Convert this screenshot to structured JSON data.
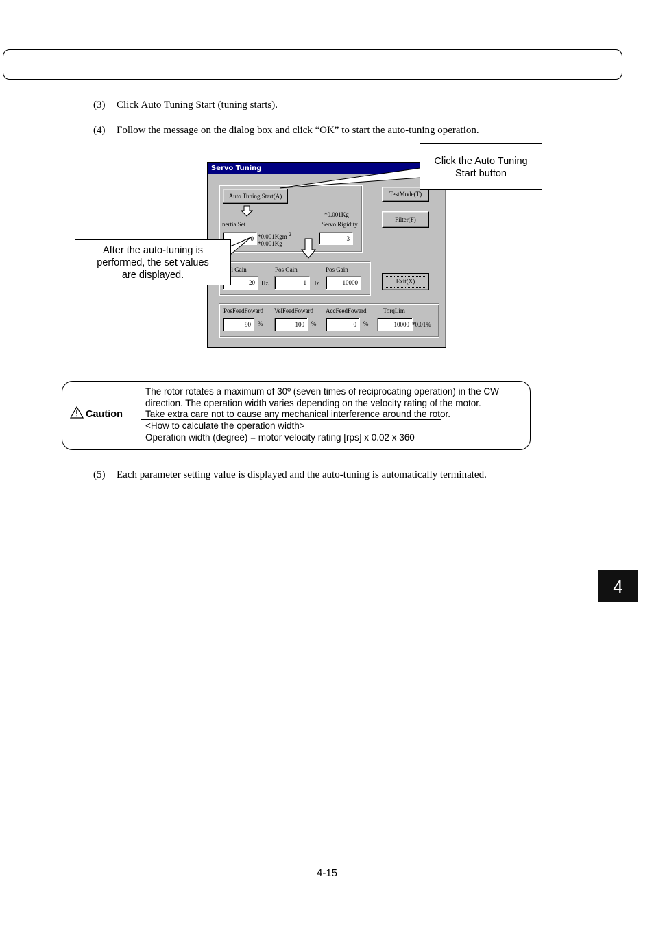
{
  "steps": [
    {
      "num": "(3)",
      "text": "Click Auto Tuning Start (tuning starts)."
    },
    {
      "num": "(4)",
      "text": "Follow the message on the dialog box and click “OK” to start the auto-tuning operation."
    },
    {
      "num": "(5)",
      "text": "Each parameter setting value is displayed and the auto-tuning is automatically terminated."
    }
  ],
  "dialog": {
    "title": "Servo Tuning",
    "auto_tuning_button": "Auto Tuning Start(A)",
    "test_mode_button": "TestMode(T)",
    "filter_button": "Filter(F)",
    "exit_button": "Exit(X)",
    "inertia_label": "Inertia Set",
    "inertia_value": "0",
    "inertia_unit1": "*0.001Kgm",
    "inertia_unit_sup": "2",
    "inertia_unit2": "*0.001Kg",
    "rigidity_unit": "*0.001Kg",
    "rigidity_label": "Servo Rigidity",
    "rigidity_value": "3",
    "vel_gain_label": "Vel Gain",
    "vel_gain_value": "20",
    "vel_gain_unit": "Hz",
    "pos_gain_label": "Pos Gain",
    "pos_gain_value": "1",
    "pos_gain_unit": "Hz",
    "pos_gain2_label": "Pos Gain",
    "pos_gain2_value": "10000",
    "pos_ff_label": "PosFeedFoward",
    "pos_ff_value": "90",
    "pos_ff_unit": "%",
    "vel_ff_label": "VelFeedFoward",
    "vel_ff_value": "100",
    "vel_ff_unit": "%",
    "acc_ff_label": "AccFeedFoward",
    "acc_ff_value": "0",
    "acc_ff_unit": "%",
    "torq_label": "TorqLim",
    "torq_value": "10000",
    "torq_unit": "*0.01%"
  },
  "callouts": {
    "auto_tuning": [
      "Click the Auto Tuning",
      "Start button"
    ],
    "after_tuning": [
      "After the auto-tuning is",
      "performed, the set values",
      "are displayed."
    ]
  },
  "caution": {
    "label": "Caution",
    "lines": [
      "The rotor rotates a maximum of 30º (seven times of reciprocating operation) in the CW",
      "direction. The operation width varies depending on the velocity rating of the motor.",
      "Take extra care not to cause any mechanical interference around the rotor.",
      "<How to calculate the operation width>",
      "Operation width (degree) = motor velocity rating [rps] x 0.02 x 360"
    ]
  },
  "side_tab": "4",
  "page_number": "4-15"
}
